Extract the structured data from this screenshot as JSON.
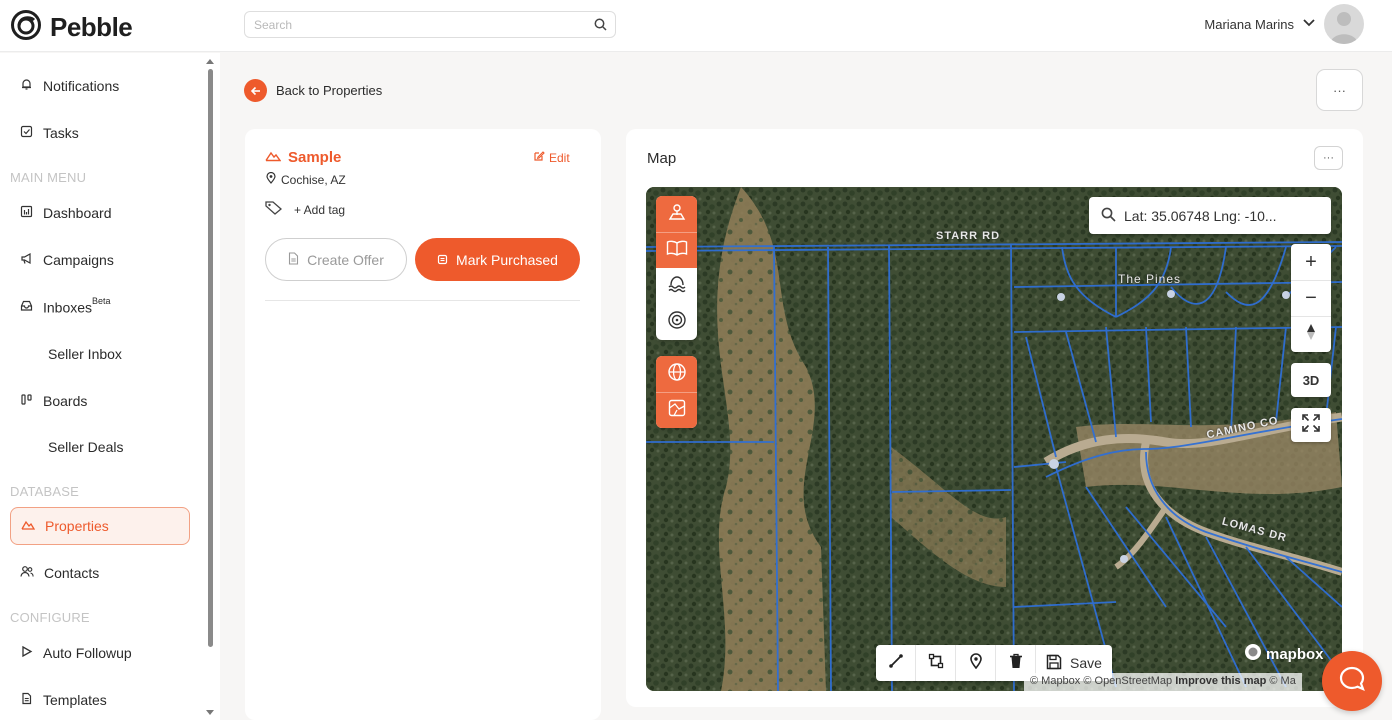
{
  "app": {
    "name": "Pebble"
  },
  "header": {
    "search_placeholder": "Search",
    "user_name": "Mariana Marins"
  },
  "sidebar": {
    "items": [
      {
        "label": "Notifications",
        "icon": "bell-icon"
      },
      {
        "label": "Tasks",
        "icon": "checkbox-icon"
      },
      {
        "section": "MAIN MENU"
      },
      {
        "label": "Dashboard",
        "icon": "dashboard-icon"
      },
      {
        "label": "Campaigns",
        "icon": "megaphone-icon"
      },
      {
        "label": "Inboxes",
        "badge": "Beta",
        "icon": "inbox-icon"
      },
      {
        "label": "Seller Inbox",
        "sub": true
      },
      {
        "label": "Boards",
        "icon": "kanban-icon"
      },
      {
        "label": "Seller Deals",
        "sub": true
      },
      {
        "section": "DATABASE"
      },
      {
        "label": "Properties",
        "icon": "mountain-icon",
        "active": true
      },
      {
        "label": "Contacts",
        "icon": "users-icon"
      },
      {
        "section": "CONFIGURE"
      },
      {
        "label": "Auto Followup",
        "icon": "play-icon"
      },
      {
        "label": "Templates",
        "icon": "document-icon"
      }
    ]
  },
  "page": {
    "back_label": "Back to Properties",
    "more_label": "···"
  },
  "property": {
    "name": "Sample",
    "edit_label": "Edit",
    "location": "Cochise, AZ",
    "add_tag_label": "+ Add tag",
    "create_offer_label": "Create Offer",
    "mark_purchased_label": "Mark Purchased"
  },
  "map": {
    "title": "Map",
    "more_label": "···",
    "search_text": "Lat: 35.06748 Lng: -10...",
    "zoom_in": "+",
    "zoom_out": "−",
    "btn_3d": "3D",
    "save_label": "Save",
    "mapbox_label": "mapbox",
    "attribution_prefix": "© Mapbox © OpenStreetMap",
    "attribution_link": "Improve this map",
    "attribution_suffix": "© Ma",
    "road_labels": [
      "STARR RD",
      "The Pines",
      "CAMINO CO",
      "LOMAS DR"
    ],
    "colors": {
      "accent": "#ee5a2c",
      "parcel_lines": "#2f6fd6"
    }
  }
}
